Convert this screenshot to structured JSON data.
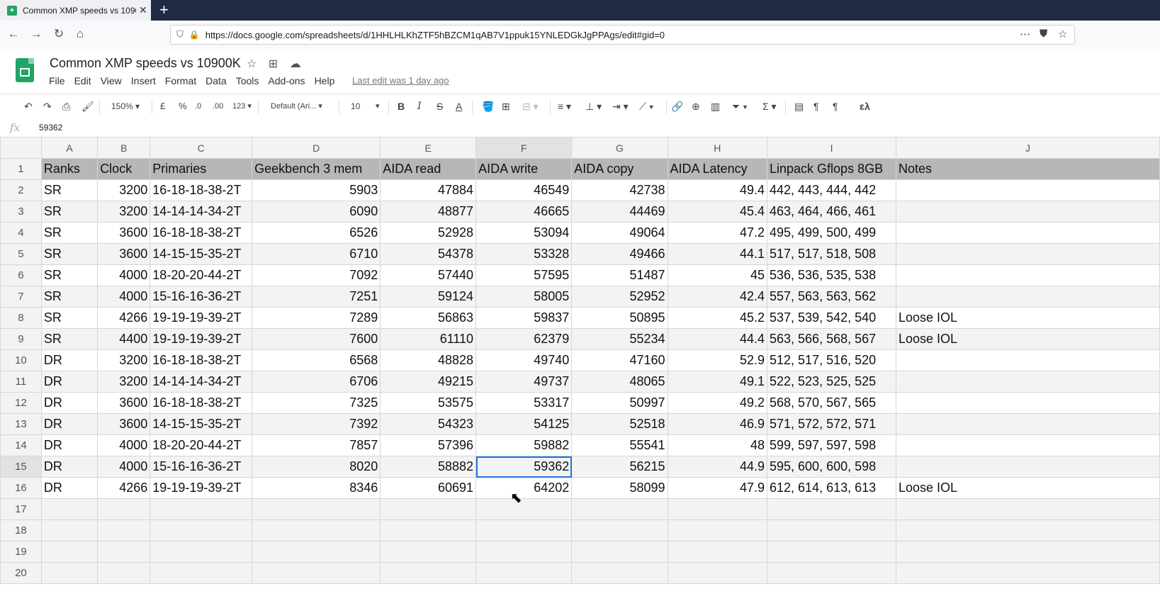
{
  "browser": {
    "tab_title": "Common XMP speeds vs 10900K",
    "url": "https://docs.google.com/spreadsheets/d/1HHLHLKhZTF5hBZCM1qAB7V1ppuk15YNLEDGkJgPPAgs/edit#gid=0"
  },
  "doc": {
    "title": "Common XMP speeds vs 10900K",
    "last_edit": "Last edit was 1 day ago",
    "menu": [
      "File",
      "Edit",
      "View",
      "Insert",
      "Format",
      "Data",
      "Tools",
      "Add-ons",
      "Help"
    ]
  },
  "toolbar": {
    "zoom": "150%",
    "currency": "£",
    "percent": "%",
    "dec_less": ".0",
    "dec_more": ".00",
    "format_more": "123",
    "font": "Default (Ari...",
    "font_size": "10",
    "bold": "B",
    "italic": "I",
    "strike": "S",
    "text_color": "A"
  },
  "formula_bar": {
    "fx": "fx",
    "value": "59362"
  },
  "columns": [
    "A",
    "B",
    "C",
    "D",
    "E",
    "F",
    "G",
    "H",
    "I",
    "J"
  ],
  "selected_column": "F",
  "selected_row": 15,
  "header": [
    "Ranks",
    "Clock",
    "Primaries",
    "Geekbench 3 mem",
    "AIDA read",
    "AIDA write",
    "AIDA copy",
    "AIDA Latency",
    "Linpack Gflops 8GB",
    "Notes"
  ],
  "rows": [
    [
      "SR",
      "3200",
      "16-18-18-38-2T",
      "5903",
      "47884",
      "46549",
      "42738",
      "49.4",
      "442, 443, 444, 442",
      ""
    ],
    [
      "SR",
      "3200",
      "14-14-14-34-2T",
      "6090",
      "48877",
      "46665",
      "44469",
      "45.4",
      "463, 464, 466, 461",
      ""
    ],
    [
      "SR",
      "3600",
      "16-18-18-38-2T",
      "6526",
      "52928",
      "53094",
      "49064",
      "47.2",
      "495, 499, 500, 499",
      ""
    ],
    [
      "SR",
      "3600",
      "14-15-15-35-2T",
      "6710",
      "54378",
      "53328",
      "49466",
      "44.1",
      "517, 517, 518, 508",
      ""
    ],
    [
      "SR",
      "4000",
      "18-20-20-44-2T",
      "7092",
      "57440",
      "57595",
      "51487",
      "45",
      "536, 536, 535, 538",
      ""
    ],
    [
      "SR",
      "4000",
      "15-16-16-36-2T",
      "7251",
      "59124",
      "58005",
      "52952",
      "42.4",
      "557, 563, 563, 562",
      ""
    ],
    [
      "SR",
      "4266",
      "19-19-19-39-2T",
      "7289",
      "56863",
      "59837",
      "50895",
      "45.2",
      "537, 539, 542, 540",
      "Loose IOL"
    ],
    [
      "SR",
      "4400",
      "19-19-19-39-2T",
      "7600",
      "61110",
      "62379",
      "55234",
      "44.4",
      "563, 566, 568, 567",
      "Loose IOL"
    ],
    [
      "DR",
      "3200",
      "16-18-18-38-2T",
      "6568",
      "48828",
      "49740",
      "47160",
      "52.9",
      "512, 517, 516, 520",
      ""
    ],
    [
      "DR",
      "3200",
      "14-14-14-34-2T",
      "6706",
      "49215",
      "49737",
      "48065",
      "49.1",
      "522, 523, 525, 525",
      ""
    ],
    [
      "DR",
      "3600",
      "16-18-18-38-2T",
      "7325",
      "53575",
      "53317",
      "50997",
      "49.2",
      "568, 570, 567, 565",
      ""
    ],
    [
      "DR",
      "3600",
      "14-15-15-35-2T",
      "7392",
      "54323",
      "54125",
      "52518",
      "46.9",
      "571, 572, 572, 571",
      ""
    ],
    [
      "DR",
      "4000",
      "18-20-20-44-2T",
      "7857",
      "57396",
      "59882",
      "55541",
      "48",
      "599, 597, 597, 598",
      ""
    ],
    [
      "DR",
      "4000",
      "15-16-16-36-2T",
      "8020",
      "58882",
      "59362",
      "56215",
      "44.9",
      "595, 600, 600, 598",
      ""
    ],
    [
      "DR",
      "4266",
      "19-19-19-39-2T",
      "8346",
      "60691",
      "64202",
      "58099",
      "47.9",
      "612, 614, 613, 613",
      "Loose IOL"
    ]
  ],
  "empty_rows": [
    17,
    18,
    19,
    20
  ]
}
